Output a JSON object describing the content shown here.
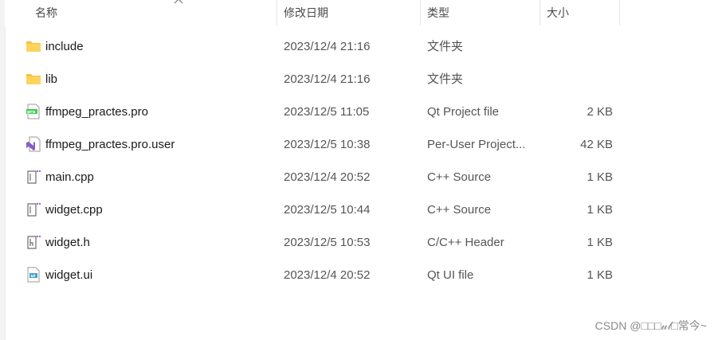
{
  "columns": {
    "name": "名称",
    "date": "修改日期",
    "type": "类型",
    "size": "大小"
  },
  "sort_indicator": "^",
  "files": [
    {
      "name": "include",
      "date": "2023/12/4 21:16",
      "type": "文件夹",
      "size": "",
      "icon": "folder-icon"
    },
    {
      "name": "lib",
      "date": "2023/12/4 21:16",
      "type": "文件夹",
      "size": "",
      "icon": "folder-icon"
    },
    {
      "name": "ffmpeg_practes.pro",
      "date": "2023/12/5 11:05",
      "type": "Qt Project file",
      "size": "2 KB",
      "icon": "qt-pro-file-icon"
    },
    {
      "name": "ffmpeg_practes.pro.user",
      "date": "2023/12/5 10:38",
      "type": "Per-User Project...",
      "size": "42 KB",
      "icon": "visual-studio-file-icon"
    },
    {
      "name": "main.cpp",
      "date": "2023/12/4 20:52",
      "type": "C++ Source",
      "size": "1 KB",
      "icon": "cpp-source-icon"
    },
    {
      "name": "widget.cpp",
      "date": "2023/12/5 10:44",
      "type": "C++ Source",
      "size": "1 KB",
      "icon": "cpp-source-icon"
    },
    {
      "name": "widget.h",
      "date": "2023/12/5 10:53",
      "type": "C/C++ Header",
      "size": "1 KB",
      "icon": "cpp-header-icon"
    },
    {
      "name": "widget.ui",
      "date": "2023/12/4 20:52",
      "type": "Qt UI file",
      "size": "1 KB",
      "icon": "qt-ui-file-icon"
    }
  ],
  "watermark": "CSDN @□□□𝓊𝓁□常今~",
  "colors": {
    "folder": "#f5c242",
    "qt_green": "#41cd52",
    "vs_purple": "#865fc5",
    "hover": "#e5f3ff"
  }
}
